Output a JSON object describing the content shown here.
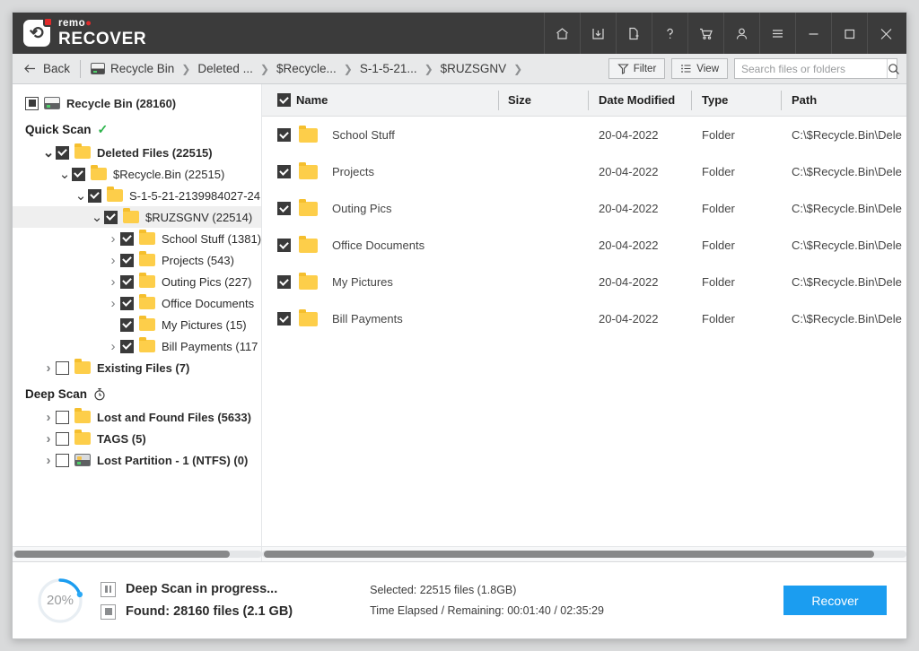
{
  "window": {
    "brand_small": "remo",
    "brand_big": "RECOVER"
  },
  "titlebar_icons": [
    {
      "name": "home-icon",
      "label": "Home"
    },
    {
      "name": "save-icon",
      "label": "Save Recovery Session"
    },
    {
      "name": "new-file-icon",
      "label": "New Scan"
    },
    {
      "name": "help-icon",
      "label": "Help"
    },
    {
      "name": "cart-icon",
      "label": "Buy"
    },
    {
      "name": "user-icon",
      "label": "Account"
    },
    {
      "name": "menu-icon",
      "label": "Menu"
    },
    {
      "name": "minimize-icon",
      "label": "Minimize"
    },
    {
      "name": "maximize-icon",
      "label": "Maximize"
    },
    {
      "name": "close-icon",
      "label": "Close"
    }
  ],
  "toolbar": {
    "back_label": "Back",
    "breadcrumbs": [
      {
        "label": "Recycle Bin",
        "icon": "drive-icon"
      },
      {
        "label": "Deleted ...",
        "icon": ""
      },
      {
        "label": "$Recycle...",
        "icon": ""
      },
      {
        "label": "S-1-5-21...",
        "icon": ""
      },
      {
        "label": "$RUZSGNV",
        "icon": ""
      }
    ],
    "filter_label": "Filter",
    "view_label": "View",
    "search_placeholder": "Search files or folders",
    "search_value": ""
  },
  "sidebar": {
    "root": {
      "label": "Recycle Bin (28160)",
      "checkbox": "partial",
      "icon": "drive-icon"
    },
    "quick_scan": {
      "label": "Quick Scan",
      "status_icon": "check-icon"
    },
    "quick_items": [
      {
        "label": "Deleted Files (22515)",
        "indent": 1,
        "chevron": "open",
        "checkbox": "on",
        "bold": true,
        "selected": false
      },
      {
        "label": "$Recycle.Bin (22515)",
        "indent": 2,
        "chevron": "open",
        "checkbox": "on",
        "bold": false,
        "selected": false
      },
      {
        "label": "S-1-5-21-2139984027-24",
        "indent": 3,
        "chevron": "open",
        "checkbox": "on",
        "bold": false,
        "selected": false
      },
      {
        "label": "$RUZSGNV (22514)",
        "indent": 4,
        "chevron": "open",
        "checkbox": "on",
        "bold": false,
        "selected": true
      },
      {
        "label": "School Stuff (1381)",
        "indent": 5,
        "chevron": "closed",
        "checkbox": "on",
        "bold": false,
        "selected": false
      },
      {
        "label": "Projects (543)",
        "indent": 5,
        "chevron": "closed",
        "checkbox": "on",
        "bold": false,
        "selected": false
      },
      {
        "label": "Outing Pics (227)",
        "indent": 5,
        "chevron": "closed",
        "checkbox": "on",
        "bold": false,
        "selected": false
      },
      {
        "label": "Office Documents",
        "indent": 5,
        "chevron": "closed",
        "checkbox": "on",
        "bold": false,
        "selected": false
      },
      {
        "label": "My Pictures (15)",
        "indent": 5,
        "chevron": "none",
        "checkbox": "on",
        "bold": false,
        "selected": false
      },
      {
        "label": "Bill Payments (117",
        "indent": 5,
        "chevron": "closed",
        "checkbox": "on",
        "bold": false,
        "selected": false
      },
      {
        "label": "Existing Files (7)",
        "indent": 1,
        "chevron": "closed",
        "checkbox": "off",
        "bold": true,
        "selected": false
      }
    ],
    "deep_scan": {
      "label": "Deep Scan",
      "status_icon": "stopwatch-icon"
    },
    "deep_items": [
      {
        "label": "Lost and Found Files (5633)",
        "indent": 1,
        "chevron": "closed",
        "checkbox": "off",
        "bold": true,
        "icon": "folder",
        "selected": false
      },
      {
        "label": "TAGS (5)",
        "indent": 1,
        "chevron": "closed",
        "checkbox": "off",
        "bold": true,
        "icon": "folder",
        "selected": false
      },
      {
        "label": "Lost Partition - 1 (NTFS) (0)",
        "indent": 1,
        "chevron": "closed",
        "checkbox": "off",
        "bold": true,
        "icon": "disk",
        "selected": false
      }
    ]
  },
  "filelist": {
    "header_checkbox": "on",
    "columns": [
      "Name",
      "Size",
      "Date Modified",
      "Type",
      "Path"
    ],
    "rows": [
      {
        "checked": true,
        "name": "School Stuff",
        "size": "",
        "date": "20-04-2022",
        "type": "Folder",
        "path": "C:\\$Recycle.Bin\\Dele"
      },
      {
        "checked": true,
        "name": "Projects",
        "size": "",
        "date": "20-04-2022",
        "type": "Folder",
        "path": "C:\\$Recycle.Bin\\Dele"
      },
      {
        "checked": true,
        "name": "Outing Pics",
        "size": "",
        "date": "20-04-2022",
        "type": "Folder",
        "path": "C:\\$Recycle.Bin\\Dele"
      },
      {
        "checked": true,
        "name": "Office Documents",
        "size": "",
        "date": "20-04-2022",
        "type": "Folder",
        "path": "C:\\$Recycle.Bin\\Dele"
      },
      {
        "checked": true,
        "name": "My Pictures",
        "size": "",
        "date": "20-04-2022",
        "type": "Folder",
        "path": "C:\\$Recycle.Bin\\Dele"
      },
      {
        "checked": true,
        "name": "Bill Payments",
        "size": "",
        "date": "20-04-2022",
        "type": "Folder",
        "path": "C:\\$Recycle.Bin\\Dele"
      }
    ]
  },
  "status": {
    "progress_percent": "20%",
    "progress_value": 20,
    "scan_line": "Deep Scan in progress...",
    "found_line": "Found: 28160 files (2.1 GB)",
    "selected_line": "Selected: 22515 files (1.8GB)",
    "time_line": "Time Elapsed / Remaining: 00:01:40 / 02:35:29",
    "recover_label": "Recover"
  },
  "colors": {
    "accent": "#1b9df0",
    "titlebar": "#3b3b3b",
    "brand_red": "#e02b2b",
    "folder": "#fdce4a",
    "success": "#2bb34a"
  }
}
